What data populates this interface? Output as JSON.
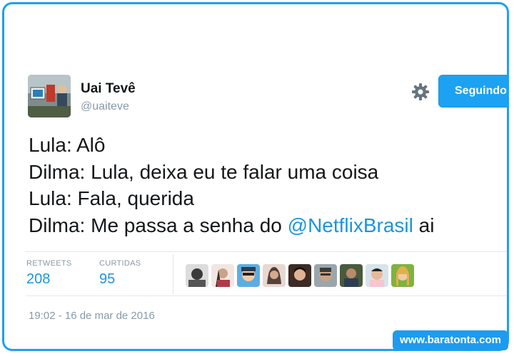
{
  "author": {
    "name": "Uai Tevê",
    "handle": "@uaiteve",
    "avatar": "avatar-photo"
  },
  "actions": {
    "settings_icon": "gear-icon",
    "follow_label": "Seguindo"
  },
  "tweet": {
    "lines": [
      "Lula: Alô",
      "Dilma: Lula, deixa eu te falar uma coisa",
      "Lula: Fala, querida"
    ],
    "last_line_prefix": "Dilma: Me passa a senha do ",
    "mention": "@NetflixBrasil",
    "last_line_suffix": " ai"
  },
  "stats": {
    "retweets_label": "RETWEETS",
    "retweets_count": "208",
    "likes_label": "CURTIDAS",
    "likes_count": "95",
    "liker_avatars": [
      "liker-avatar-1",
      "liker-avatar-2",
      "liker-avatar-3",
      "liker-avatar-4",
      "liker-avatar-5",
      "liker-avatar-6",
      "liker-avatar-7",
      "liker-avatar-8",
      "liker-avatar-9"
    ]
  },
  "timestamp": "19:02 - 16 de mar de 2016",
  "watermark": "www.baratonta.com",
  "colors": {
    "accent": "#1da1f2",
    "link": "#1b95e0",
    "muted": "#8899a6",
    "text": "#14171a"
  }
}
